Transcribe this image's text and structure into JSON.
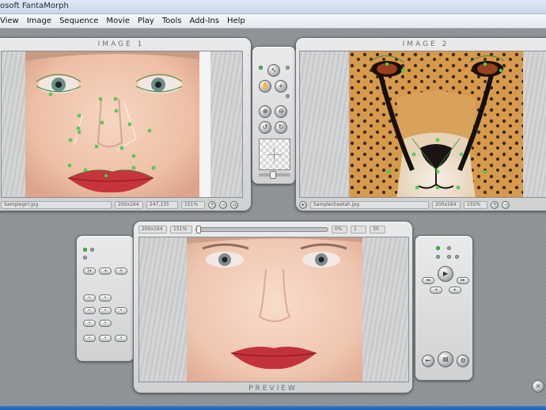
{
  "window": {
    "title": "osoft FantaMorph"
  },
  "menu": [
    "View",
    "Image",
    "Sequence",
    "Movie",
    "Play",
    "Tools",
    "Add-Ins",
    "Help"
  ],
  "image1": {
    "title": "IMAGE 1",
    "filename": "Samplegirl.jpg",
    "size": "200x164",
    "coords": "247,135",
    "zoom": "151%"
  },
  "image2": {
    "title": "IMAGE 2",
    "filename": "Samplecheetah.jpg",
    "size": "200x164",
    "zoom": "155%"
  },
  "preview": {
    "title": "PREVIEW",
    "size": "200x164",
    "zoom": "151%",
    "percent": "0%",
    "frame": "1",
    "total": "30"
  },
  "colors": {
    "accent": "#3ecf3e",
    "panel": "#d9dbdc",
    "workspace": "#909395",
    "status": "#1b5fb0"
  }
}
